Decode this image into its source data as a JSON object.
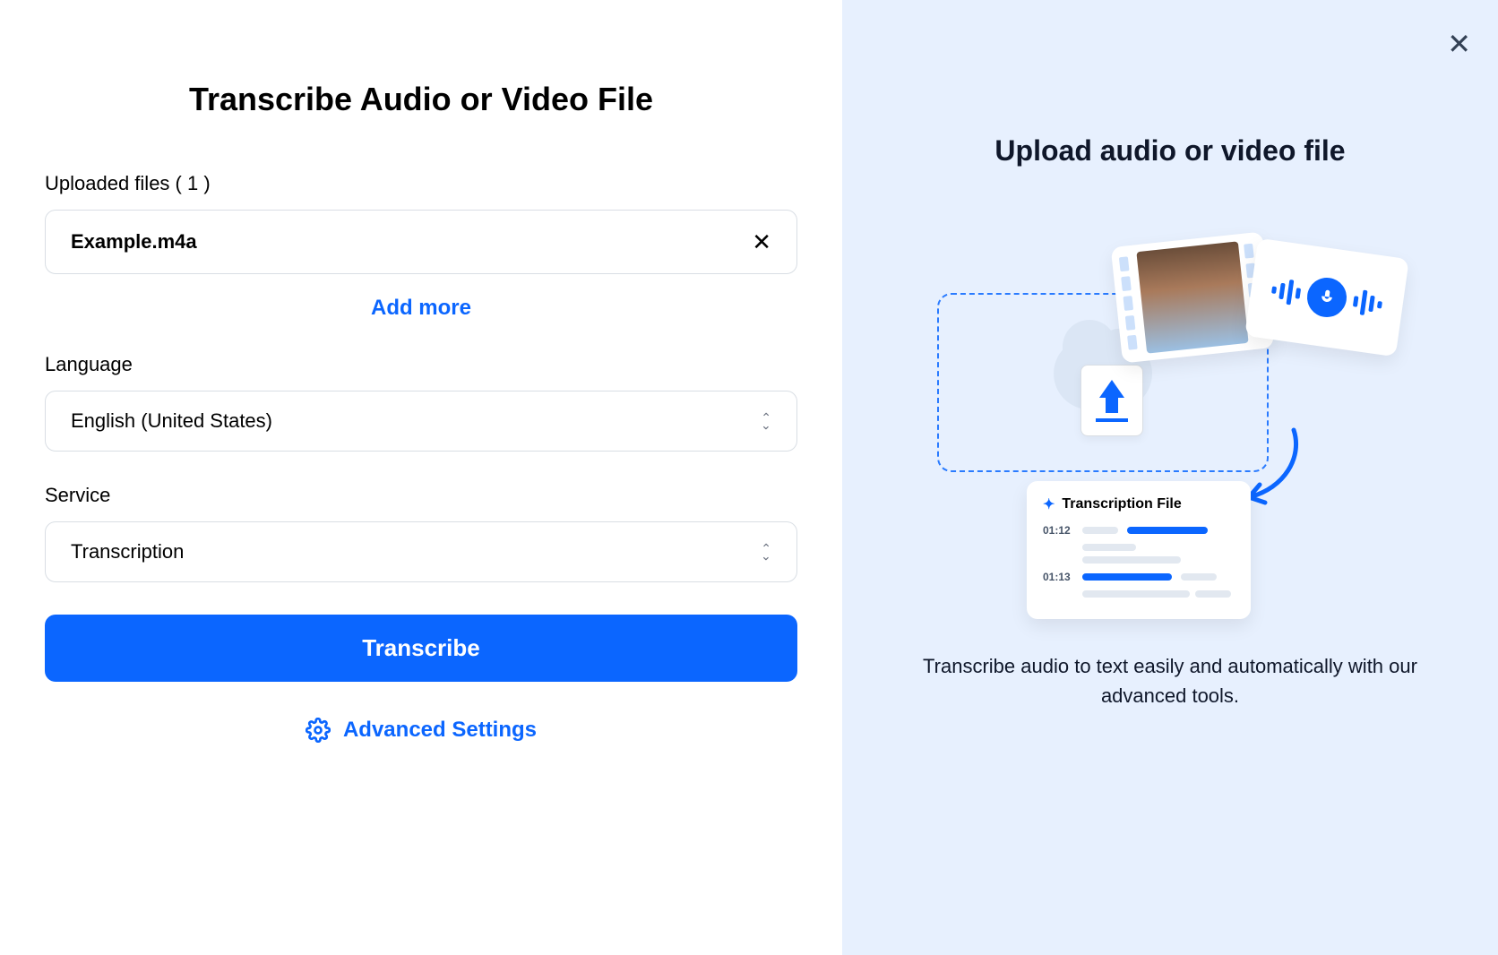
{
  "left": {
    "title": "Transcribe Audio or Video File",
    "uploaded_label_prefix": "Uploaded files",
    "uploaded_count": "1",
    "file_name": "Example.m4a",
    "add_more": "Add more",
    "language_label": "Language",
    "language_value": "English (United States)",
    "service_label": "Service",
    "service_value": "Transcription",
    "transcribe_button": "Transcribe",
    "advanced_settings": "Advanced Settings"
  },
  "right": {
    "title": "Upload audio or video file",
    "trans_file_label": "Transcription File",
    "ts1": "01:12",
    "ts2": "01:13",
    "description": "Transcribe audio to text easily and automatically with our advanced tools."
  }
}
